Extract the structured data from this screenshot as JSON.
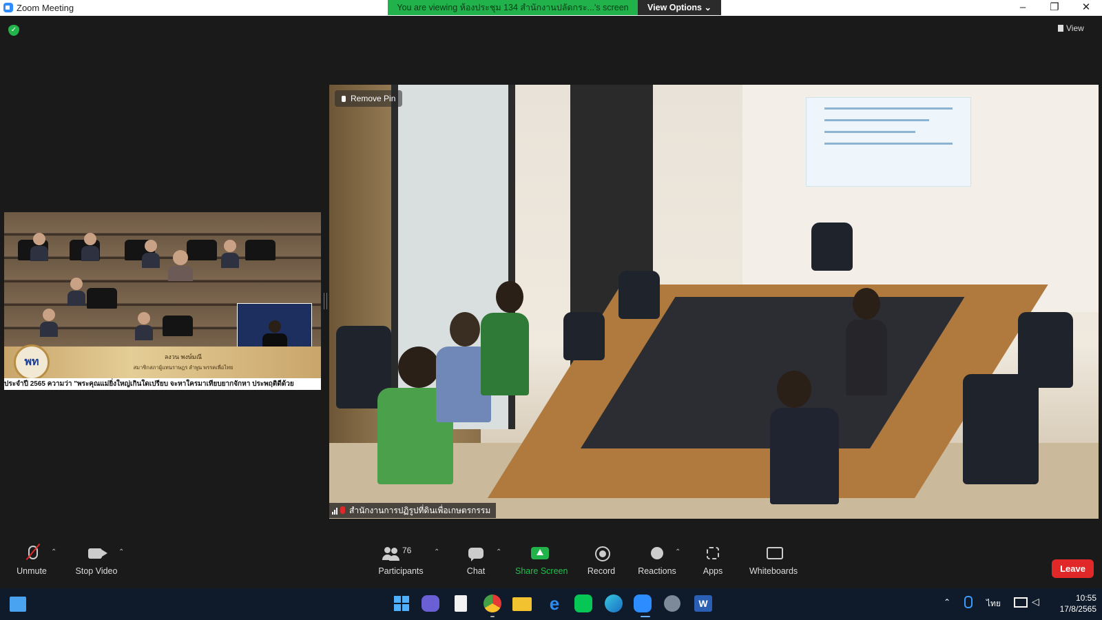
{
  "window": {
    "title": "Zoom Meeting",
    "minimize": "–",
    "restore": "❐",
    "close": "✕"
  },
  "share_banner": {
    "prefix": "You are viewing",
    "sharer": "ห้องประชุม 134 สำนักงานปลัดกระ...",
    "suffix": "'s screen",
    "view_options": "View Options ⌄"
  },
  "top_right": {
    "view_label": "View"
  },
  "small_video": {
    "logo_text": "พท",
    "speaker_name": "ลงวน พงษ์มณี",
    "speaker_title": "สมาชิกสภาผู้แทนราษฎร ลำพูน พรรคเพื่อไทย",
    "ticker": "ประจำปี 2565 ความว่า \"พระคุณแม่ยิ่งใหญ่เกินใดเปรียบ จะหาใครมาเทียบยากจักหา ประพฤติดีด้วย"
  },
  "main_video": {
    "remove_pin": "Remove Pin",
    "participant_name": "สำนักงานการปฏิรูปที่ดินเพื่อเกษตรกรรม"
  },
  "toolbar": {
    "unmute": "Unmute",
    "stop_video": "Stop Video",
    "participants": "Participants",
    "participants_count": "76",
    "chat": "Chat",
    "share_screen": "Share Screen",
    "record": "Record",
    "reactions": "Reactions",
    "apps": "Apps",
    "whiteboards": "Whiteboards",
    "leave": "Leave",
    "caret": "⌃"
  },
  "taskbar": {
    "clock_time": "10:55",
    "clock_date": "17/8/2565",
    "language": "ไทย",
    "tray_chevron": "⌃"
  },
  "colors": {
    "share_green": "#21b24b",
    "leave_red": "#e02828",
    "toolbar_bg": "#1a1a1a",
    "taskbar_bg": "#0f1a2a"
  }
}
